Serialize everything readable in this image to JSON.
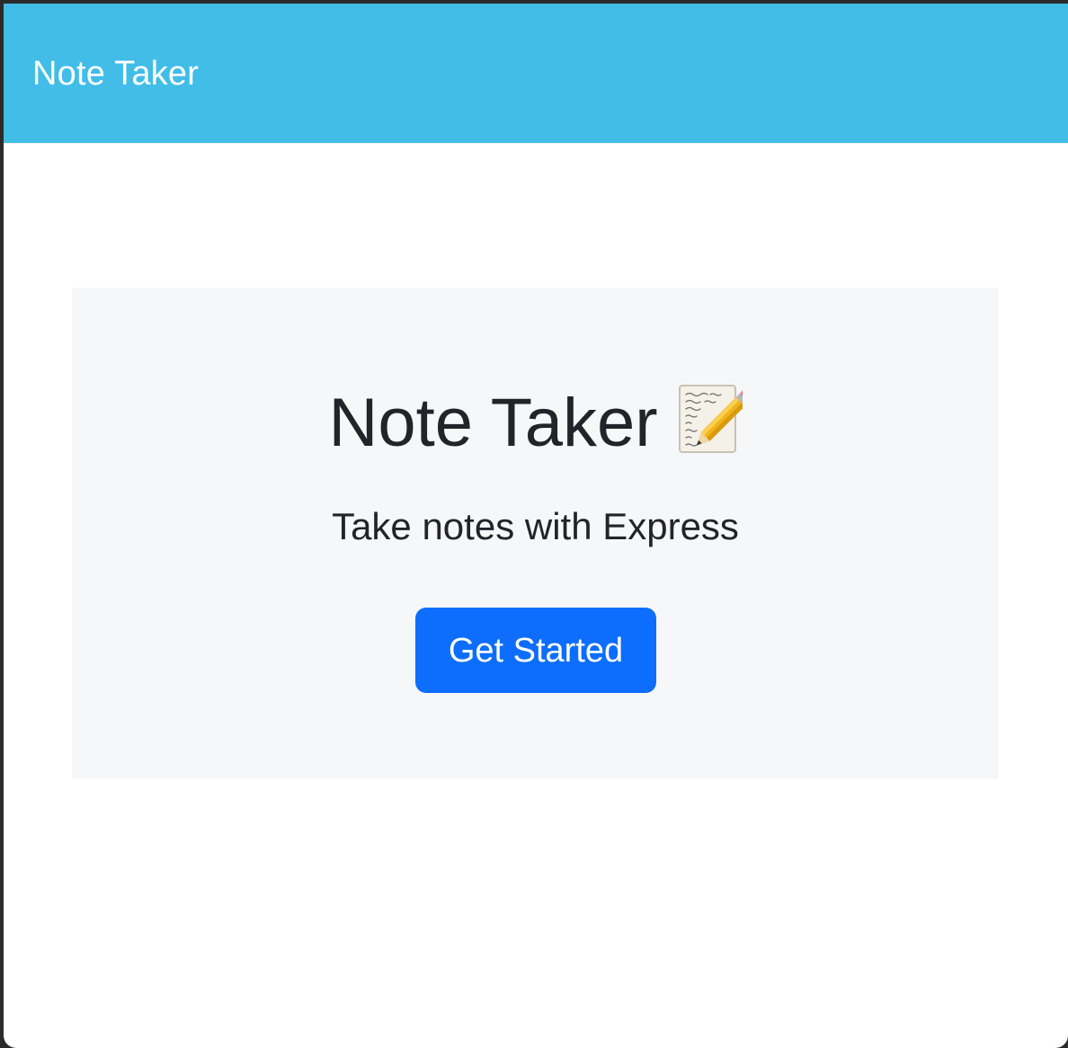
{
  "navbar": {
    "brand": "Note Taker",
    "background_color": "#41bde8"
  },
  "hero": {
    "title": "Note Taker",
    "title_icon": "memo-icon",
    "subtitle": "Take notes with Express",
    "button_label": "Get Started",
    "button_color": "#0d6efd",
    "background_color": "#f6f7f9"
  }
}
